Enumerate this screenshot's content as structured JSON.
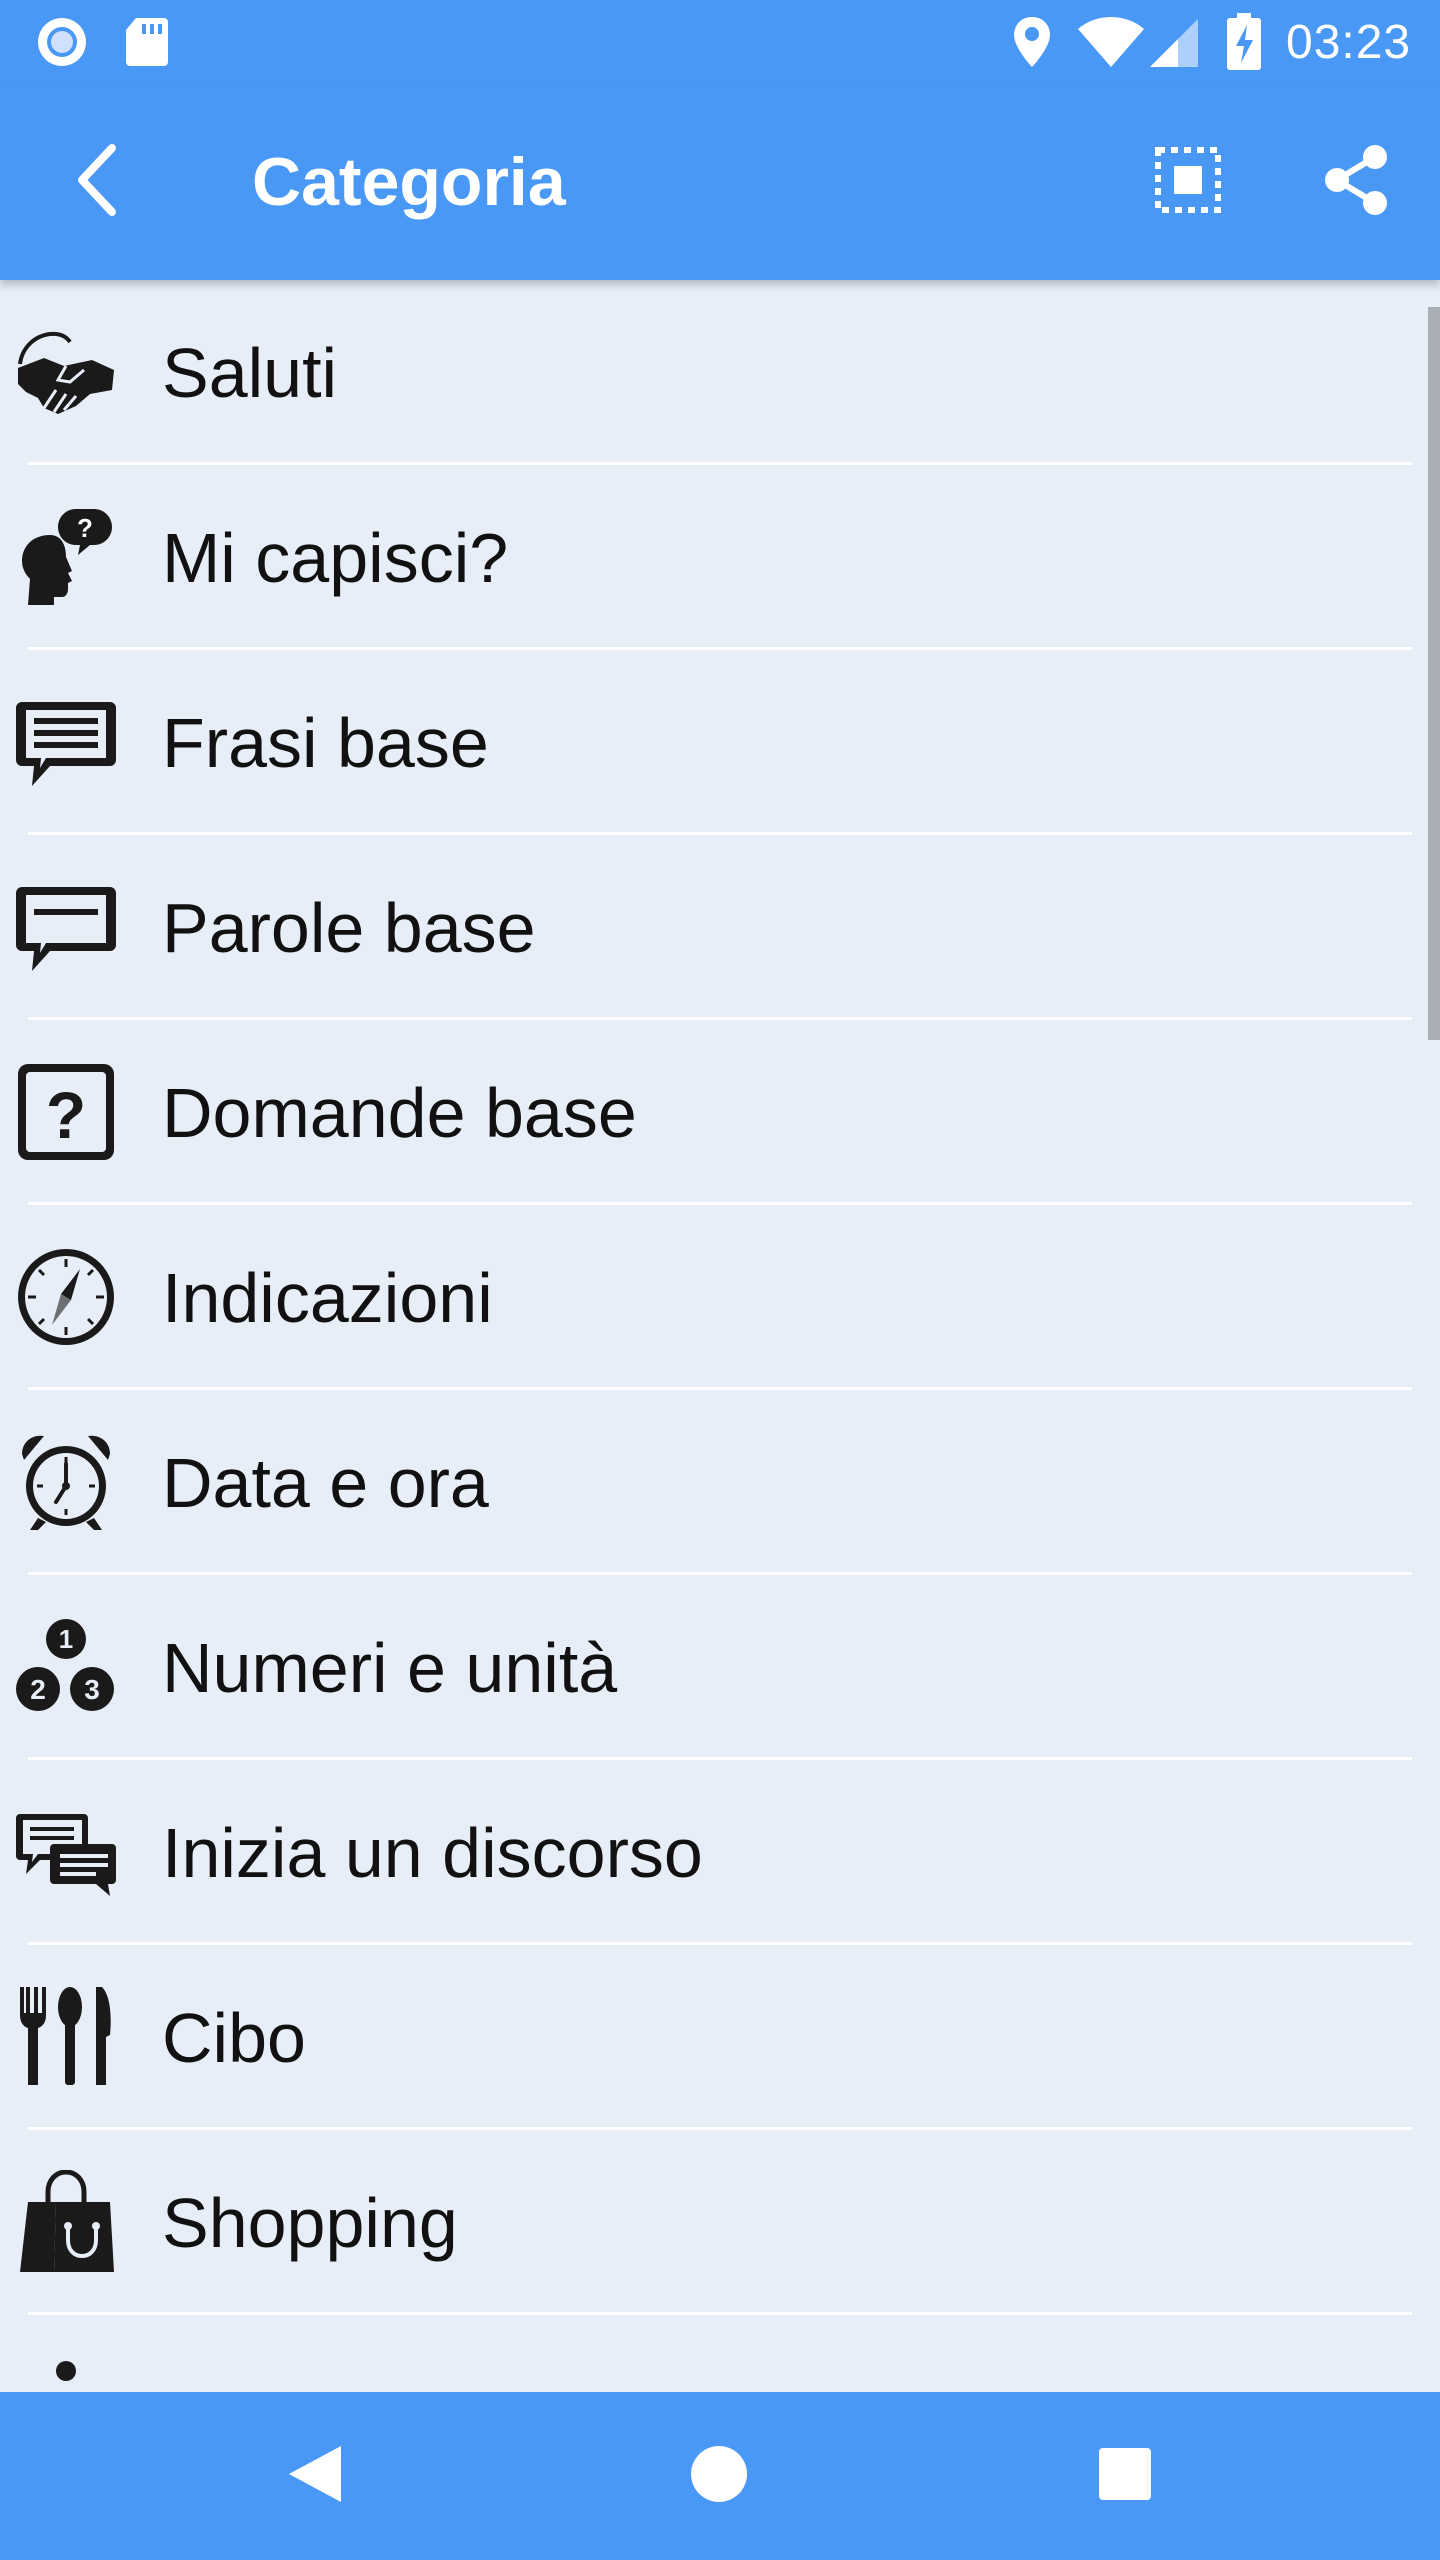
{
  "status_bar": {
    "time": "03:23",
    "left_icons": [
      "notification-circle-icon",
      "sd-card-icon"
    ],
    "right_icons": [
      "location-pin-icon",
      "wifi-icon",
      "cell-signal-icon",
      "battery-charging-icon"
    ]
  },
  "app_bar": {
    "title": "Categoria",
    "back_icon": "back-arrow-icon",
    "actions": [
      "select-all-icon",
      "share-icon"
    ]
  },
  "categories": [
    {
      "label": "Saluti",
      "icon": "handshake-icon"
    },
    {
      "label": "Mi capisci?",
      "icon": "head-question-icon"
    },
    {
      "label": "Frasi base",
      "icon": "speech-bubble-lines-icon"
    },
    {
      "label": "Parole base",
      "icon": "speech-bubble-icon"
    },
    {
      "label": "Domande base",
      "icon": "question-box-icon"
    },
    {
      "label": "Indicazioni",
      "icon": "compass-icon"
    },
    {
      "label": "Data e ora",
      "icon": "alarm-clock-icon"
    },
    {
      "label": "Numeri e unità",
      "icon": "numbers-icon"
    },
    {
      "label": "Inizia un discorso",
      "icon": "chat-bubbles-icon"
    },
    {
      "label": "Cibo",
      "icon": "cutlery-icon"
    },
    {
      "label": "Shopping",
      "icon": "shopping-bag-icon"
    }
  ],
  "nav_bar": [
    "nav-back-icon",
    "nav-home-icon",
    "nav-recents-icon"
  ],
  "colors": {
    "primary": "#4a98f6",
    "background": "#e8eef8",
    "icon": "#1a1a1a",
    "text": "#111111"
  }
}
